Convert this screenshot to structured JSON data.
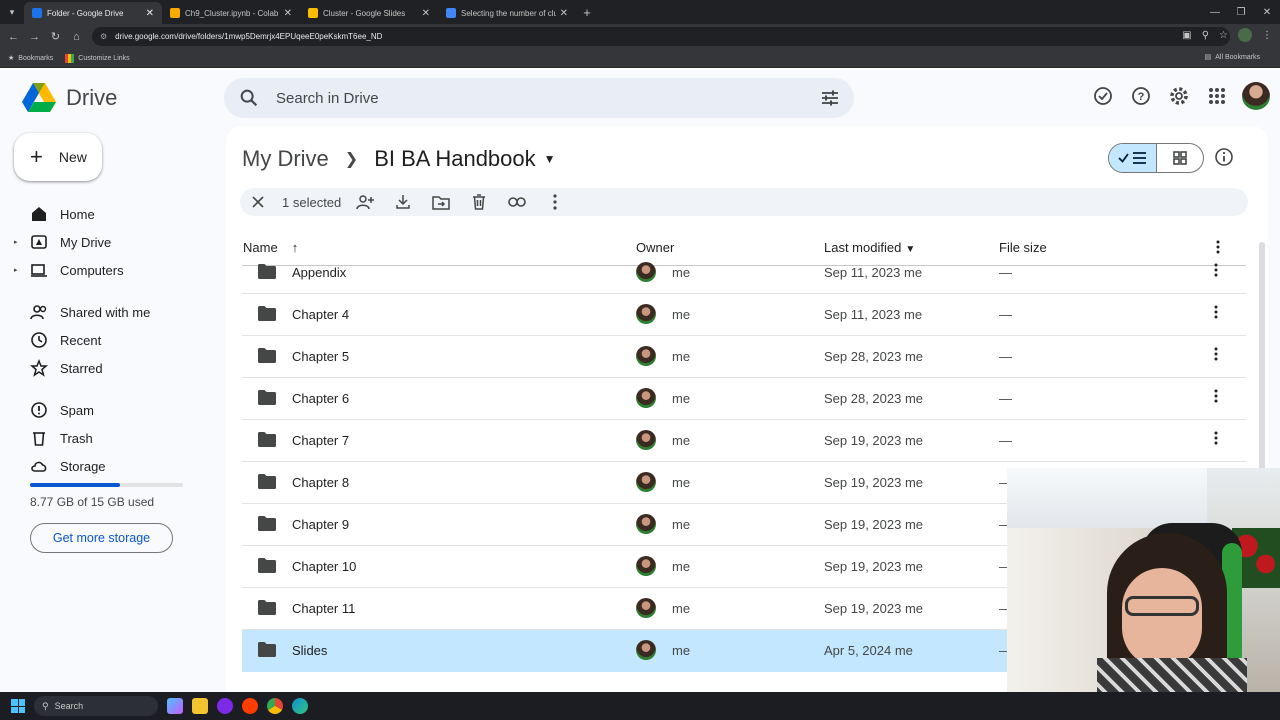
{
  "browser": {
    "tabs": [
      {
        "label": "Folder - Google Drive",
        "active": true,
        "favicon_color": "#1a73e8"
      },
      {
        "label": "Ch9_Cluster.ipynb - Colab",
        "active": false,
        "favicon_color": "#f9ab00"
      },
      {
        "label": "Cluster - Google Slides",
        "active": false,
        "favicon_color": "#fbbc04"
      },
      {
        "label": "Selecting the number of cluste",
        "active": false,
        "favicon_color": "#4285f4"
      }
    ],
    "new_tab": "+",
    "url": "drive.google.com/drive/folders/1mwp5Demrjx4EPUqeeE0peKskmT6ee_ND",
    "bookmarks": [
      {
        "label": "Bookmarks"
      },
      {
        "label": "Customize Links"
      }
    ],
    "all_bookmarks": "All Bookmarks"
  },
  "drive": {
    "logo_text": "Drive",
    "search_placeholder": "Search in Drive",
    "new_label": "New",
    "sidebar": [
      {
        "label": "Home",
        "icon": "home-icon",
        "expandable": false
      },
      {
        "label": "My Drive",
        "icon": "my-drive-icon",
        "expandable": true
      },
      {
        "label": "Computers",
        "icon": "computers-icon",
        "expandable": true
      },
      {
        "label": "Shared with me",
        "icon": "shared-icon",
        "expandable": false
      },
      {
        "label": "Recent",
        "icon": "clock-icon",
        "expandable": false
      },
      {
        "label": "Starred",
        "icon": "star-icon",
        "expandable": false
      },
      {
        "label": "Spam",
        "icon": "spam-icon",
        "expandable": false
      },
      {
        "label": "Trash",
        "icon": "trash-icon",
        "expandable": false
      },
      {
        "label": "Storage",
        "icon": "cloud-icon",
        "expandable": false
      }
    ],
    "storage": {
      "used_text": "8.77 GB of 15 GB used",
      "fraction": 0.585,
      "button": "Get more storage"
    },
    "breadcrumb": {
      "parent": "My Drive",
      "current": "BI BA Handbook"
    },
    "selection": {
      "count_text": "1 selected"
    },
    "columns": {
      "name": "Name",
      "owner": "Owner",
      "modified": "Last modified",
      "size": "File size"
    },
    "files": [
      {
        "name": "Appendix",
        "owner": "me",
        "modified": "Sep 11, 2023 me",
        "size": "—",
        "selected": false
      },
      {
        "name": "Chapter 4",
        "owner": "me",
        "modified": "Sep 11, 2023 me",
        "size": "—",
        "selected": false
      },
      {
        "name": "Chapter 5",
        "owner": "me",
        "modified": "Sep 28, 2023 me",
        "size": "—",
        "selected": false
      },
      {
        "name": "Chapter 6",
        "owner": "me",
        "modified": "Sep 28, 2023 me",
        "size": "—",
        "selected": false
      },
      {
        "name": "Chapter 7",
        "owner": "me",
        "modified": "Sep 19, 2023 me",
        "size": "—",
        "selected": false
      },
      {
        "name": "Chapter 8",
        "owner": "me",
        "modified": "Sep 19, 2023 me",
        "size": "—",
        "selected": false
      },
      {
        "name": "Chapter 9",
        "owner": "me",
        "modified": "Sep 19, 2023 me",
        "size": "—",
        "selected": false
      },
      {
        "name": "Chapter 10",
        "owner": "me",
        "modified": "Sep 19, 2023 me",
        "size": "—",
        "selected": false
      },
      {
        "name": "Chapter 11",
        "owner": "me",
        "modified": "Sep 19, 2023 me",
        "size": "—",
        "selected": false
      },
      {
        "name": "Slides",
        "owner": "me",
        "modified": "Apr 5, 2024 me",
        "size": "—",
        "selected": true
      }
    ]
  },
  "taskbar": {
    "search": "Search"
  },
  "colors": {
    "accent": "#0b57d0",
    "selected_row": "#c2e7ff",
    "search_bg": "#e9eef6"
  }
}
